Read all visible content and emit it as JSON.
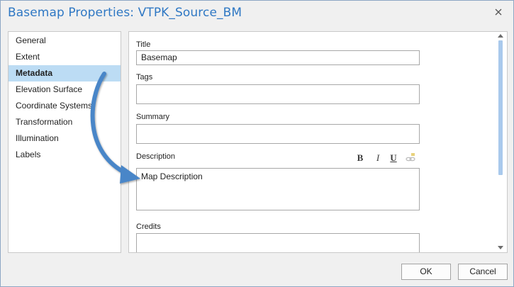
{
  "dialog": {
    "title": "Basemap Properties: VTPK_Source_BM"
  },
  "nav": {
    "items": [
      {
        "label": "General",
        "selected": false
      },
      {
        "label": "Extent",
        "selected": false
      },
      {
        "label": "Metadata",
        "selected": true
      },
      {
        "label": "Elevation Surface",
        "selected": false
      },
      {
        "label": "Coordinate Systems",
        "selected": false
      },
      {
        "label": "Transformation",
        "selected": false
      },
      {
        "label": "Illumination",
        "selected": false
      },
      {
        "label": "Labels",
        "selected": false
      }
    ]
  },
  "metadata": {
    "title_label": "Title",
    "title_value": "Basemap",
    "tags_label": "Tags",
    "tags_value": "",
    "summary_label": "Summary",
    "summary_value": "",
    "description_label": "Description",
    "description_value": "Map Description",
    "credits_label": "Credits",
    "credits_value": "",
    "format": {
      "bold": "B",
      "italic": "I",
      "underline": "U"
    }
  },
  "buttons": {
    "ok": "OK",
    "cancel": "Cancel"
  },
  "colors": {
    "title": "#2f78c4",
    "selection": "#bcdcf4",
    "annotation_arrow": "#4a86c8"
  }
}
